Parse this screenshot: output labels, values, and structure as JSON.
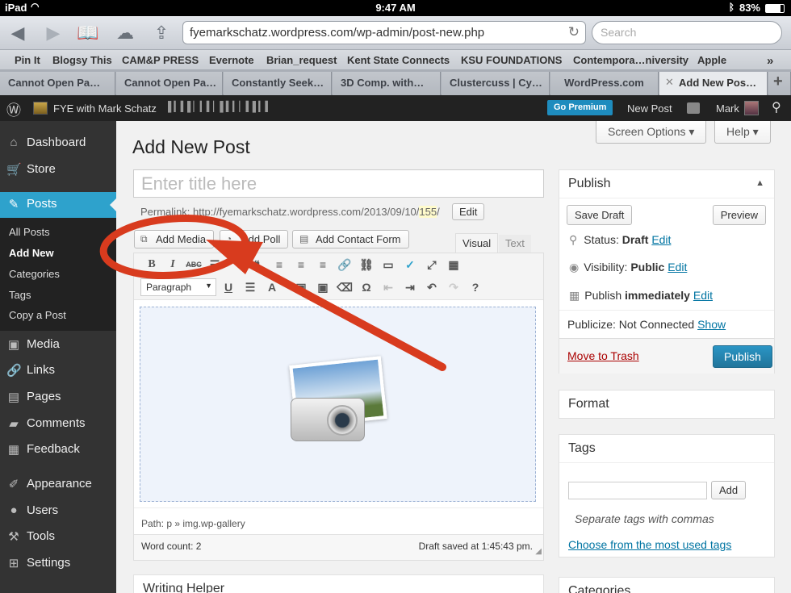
{
  "status_bar": {
    "device": "iPad",
    "time": "9:47 AM",
    "battery": "83%"
  },
  "browser": {
    "url": "fyemarkschatz.wordpress.com/wp-admin/post-new.php",
    "search_placeholder": "Search",
    "bookmarks": [
      "Pin It",
      "Blogsy This",
      "CAM&P PRESS",
      "Evernote",
      "Brian_request",
      "Kent State Connects",
      "KSU FOUNDATIONS",
      "Contempora…niversity",
      "Apple"
    ],
    "tabs": [
      "Cannot Open Pa…",
      "Cannot Open Pa…",
      "Constantly Seek…",
      "3D Comp. with…",
      "Clustercuss | Cy…",
      "WordPress.com",
      "Add New Pos…"
    ],
    "new_tab_icon": "plus-icon"
  },
  "adminbar": {
    "site_name": "FYE with Mark Schatz",
    "go_premium": "Go Premium",
    "new_post": "New Post",
    "user": "Mark"
  },
  "sidebar": {
    "items": [
      "Dashboard",
      "Store",
      "Posts",
      "Media",
      "Links",
      "Pages",
      "Comments",
      "Feedback",
      "Appearance",
      "Users",
      "Tools",
      "Settings"
    ],
    "sub_items": [
      "All Posts",
      "Add New",
      "Categories",
      "Tags",
      "Copy a Post"
    ]
  },
  "editor": {
    "page_title": "Add New Post",
    "screen_options": "Screen Options ▾",
    "help": "Help ▾",
    "title_placeholder": "Enter title here",
    "permalink_label": "Permalink:",
    "permalink_url": "http://fyemarkschatz.wordpress.com/2013/09/10/",
    "permalink_slug": "155",
    "permalink_end": "/",
    "permalink_edit": "Edit",
    "add_media": "Add Media",
    "add_poll": "Add Poll",
    "add_contact_form": "Add Contact Form",
    "tab_visual": "Visual",
    "tab_text": "Text",
    "format_select": "Paragraph",
    "path": "Path: p » img.wp-gallery",
    "word_count": "Word count: 2",
    "draft_saved": "Draft saved at 1:45:43 pm.",
    "writing_helper": "Writing Helper"
  },
  "publish_box": {
    "title": "Publish",
    "save_draft": "Save Draft",
    "preview": "Preview",
    "status_label": "Status:",
    "status_value": "Draft",
    "status_edit": "Edit",
    "visibility_label": "Visibility:",
    "visibility_value": "Public",
    "visibility_edit": "Edit",
    "publish_label": "Publish",
    "publish_value": "immediately",
    "publish_edit": "Edit",
    "publicize_label": "Publicize: Not Connected",
    "publicize_show": "Show",
    "move_to_trash": "Move to Trash",
    "publish_button": "Publish"
  },
  "format_box": {
    "title": "Format"
  },
  "tags_box": {
    "title": "Tags",
    "add": "Add",
    "hint": "Separate tags with commas",
    "choose": "Choose from the most used tags"
  },
  "categories_box": {
    "title": "Categories"
  },
  "colors": {
    "accent": "#2ea2cc",
    "annotation": "#d83b1e",
    "link": "#0074a2",
    "trash": "#a00"
  }
}
